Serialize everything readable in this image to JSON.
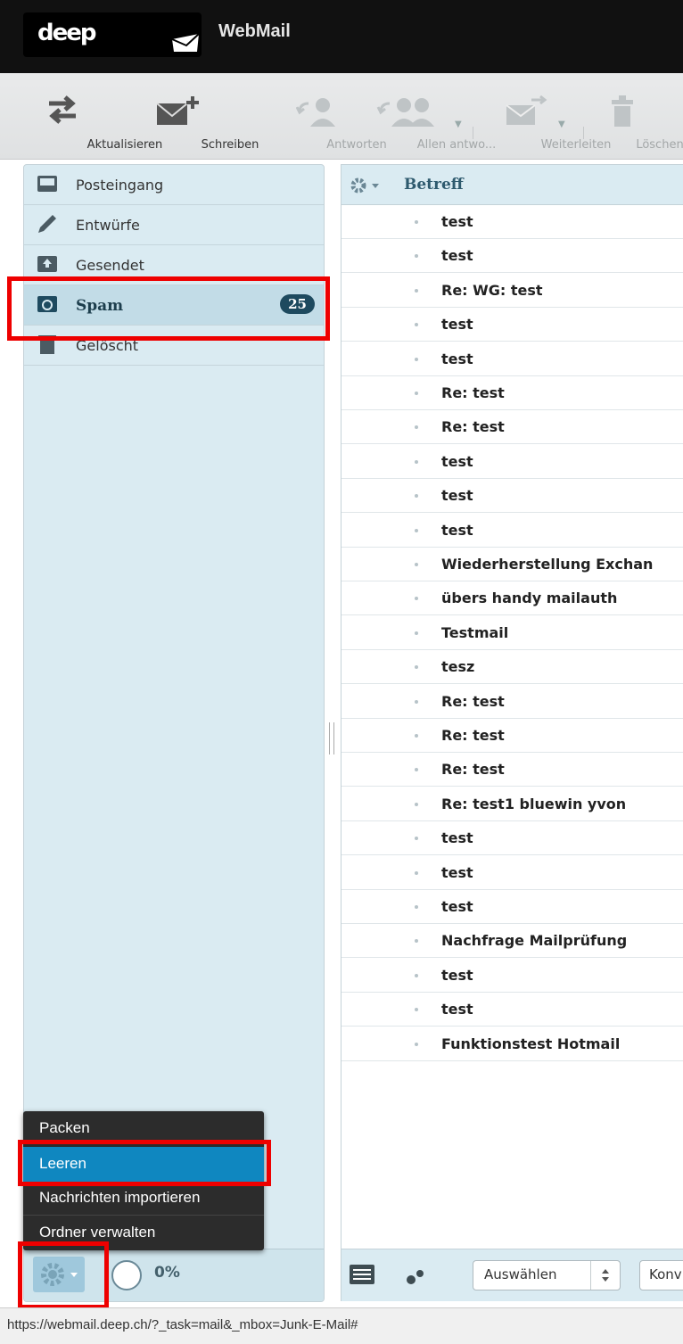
{
  "app": {
    "logo_text": "deep",
    "brand": "WebMail"
  },
  "toolbar": {
    "refresh": "Aktualisieren",
    "compose": "Schreiben",
    "reply": "Antworten",
    "reply_all": "Allen antwo...",
    "forward": "Weiterleiten",
    "delete": "Löschen"
  },
  "folders": [
    {
      "name": "Posteingang",
      "icon": "inbox-icon"
    },
    {
      "name": "Entwürfe",
      "icon": "pencil-icon"
    },
    {
      "name": "Gesendet",
      "icon": "sent-icon"
    },
    {
      "name": "Spam",
      "icon": "spam-icon",
      "count": "25",
      "selected": true
    },
    {
      "name": "Gelöscht",
      "icon": "trash-icon"
    }
  ],
  "folder_menu": {
    "items": [
      "Packen",
      "Leeren",
      "Nachrichten importieren",
      "Ordner verwalten"
    ],
    "highlighted": "Leeren"
  },
  "quota": "0%",
  "message_list": {
    "column_subject": "Betreff",
    "subjects": [
      "test",
      "test",
      "Re: WG: test",
      "test",
      "test",
      "Re: test",
      "Re: test",
      "test",
      "test",
      "test",
      "Wiederherstellung Exchan",
      "übers handy mailauth",
      "Testmail",
      "tesz",
      "Re: test",
      "Re: test",
      "Re: test",
      "Re: test1 bluewin yvon",
      "test",
      "test",
      "test",
      "Nachfrage Mailprüfung",
      "test",
      "test",
      "Funktionstest Hotmail"
    ]
  },
  "list_footer": {
    "select": "Auswählen",
    "threads": "Konv"
  },
  "statusbar": {
    "url": "https://webmail.deep.ch/?_task=mail&_mbox=Junk-E-Mail#"
  },
  "colors": {
    "accent": "#0f87c0",
    "highlight_box": "#e00000",
    "sidebar_bg": "#daebf2"
  }
}
